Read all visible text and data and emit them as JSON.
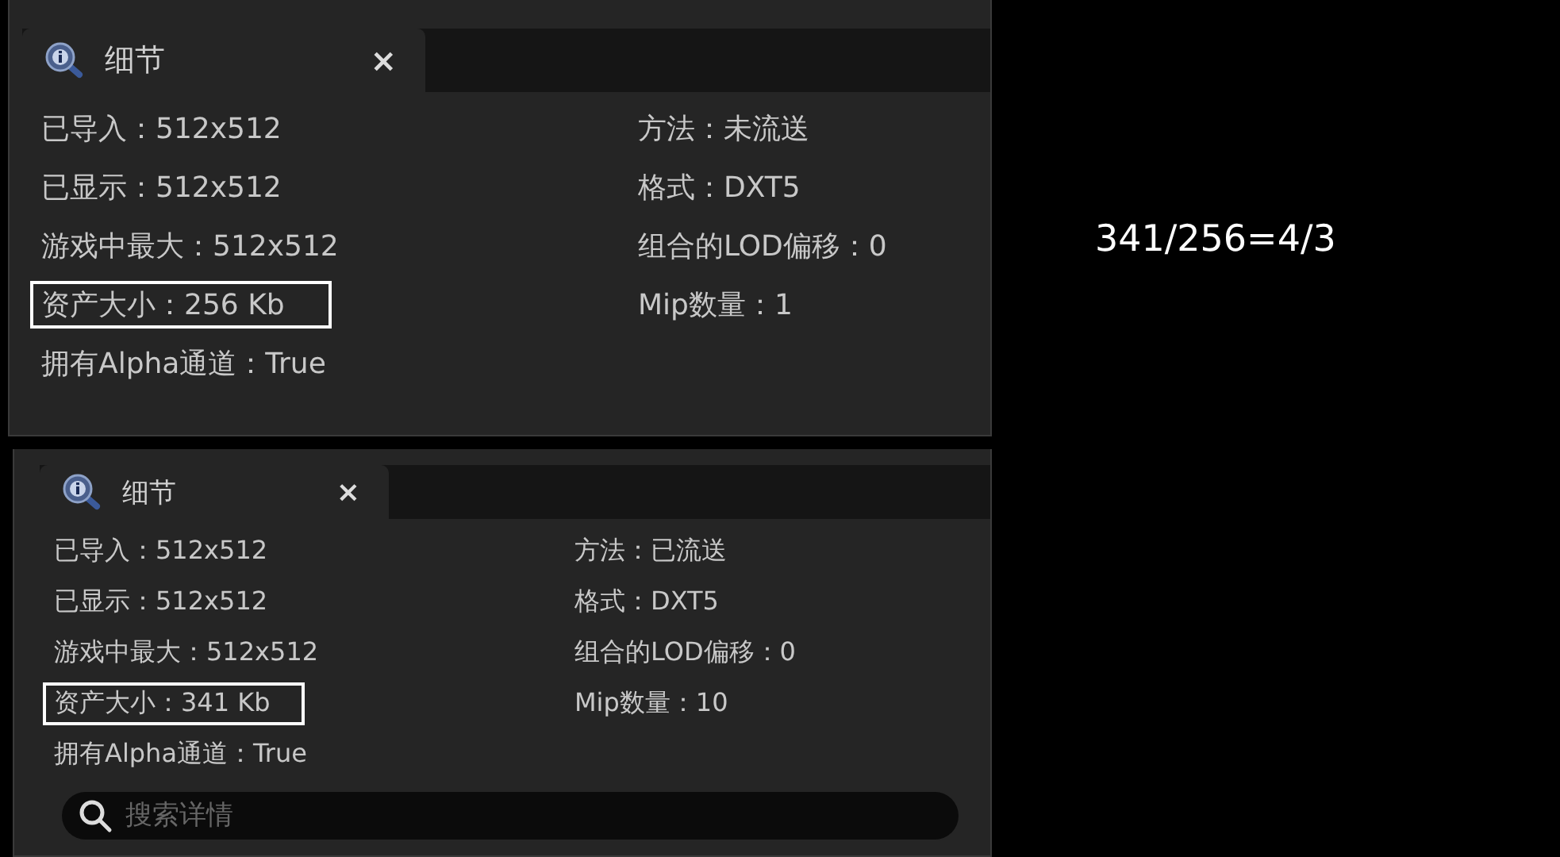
{
  "panels": [
    {
      "tab": {
        "label": "细节",
        "close": "×",
        "selected": true
      },
      "fields_left": [
        {
          "text": "已导入：512x512",
          "highlighted": false
        },
        {
          "text": "已显示：512x512",
          "highlighted": false
        },
        {
          "text": "游戏中最大：512x512",
          "highlighted": false
        },
        {
          "text": "资产大小：256 Kb",
          "highlighted": true
        },
        {
          "text": "拥有Alpha通道：True",
          "highlighted": false
        }
      ],
      "fields_right": [
        {
          "text": "方法：未流送",
          "highlighted": false
        },
        {
          "text": "格式：DXT5",
          "highlighted": false
        },
        {
          "text": "组合的LOD偏移：0",
          "highlighted": false
        },
        {
          "text": "Mip数量：1",
          "highlighted": false
        }
      ]
    },
    {
      "tab": {
        "label": "细节",
        "close": "×",
        "selected": true
      },
      "fields_left": [
        {
          "text": "已导入：512x512",
          "highlighted": false
        },
        {
          "text": "已显示：512x512",
          "highlighted": false
        },
        {
          "text": "游戏中最大：512x512",
          "highlighted": false
        },
        {
          "text": "资产大小：341 Kb",
          "highlighted": true
        },
        {
          "text": "拥有Alpha通道：True",
          "highlighted": false
        }
      ],
      "fields_right": [
        {
          "text": "方法：已流送",
          "highlighted": false
        },
        {
          "text": "格式：DXT5",
          "highlighted": false
        },
        {
          "text": "组合的LOD偏移：0",
          "highlighted": false
        },
        {
          "text": "Mip数量：10",
          "highlighted": false
        }
      ],
      "search": {
        "placeholder": "搜索详情"
      }
    }
  ],
  "annotation": "341/256=4/3"
}
